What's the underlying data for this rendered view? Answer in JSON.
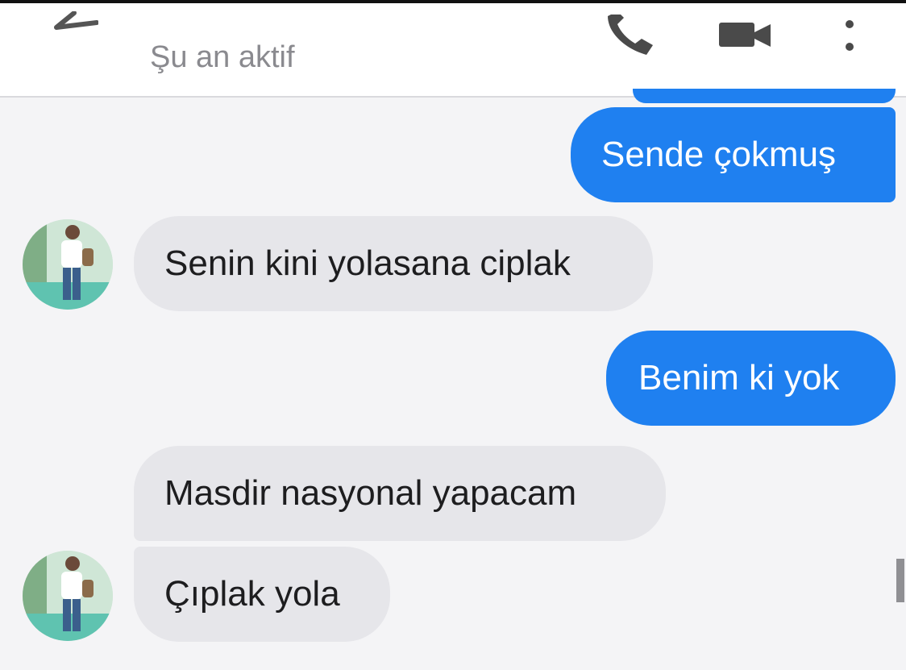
{
  "header": {
    "status": "Şu an aktif",
    "icons": {
      "back": "back-arrow-icon",
      "call": "phone-icon",
      "video": "video-camera-icon",
      "more": "more-vert-icon"
    }
  },
  "messages": [
    {
      "direction": "sent",
      "text": "Sende çokmuş"
    },
    {
      "direction": "received",
      "text": "Senin kini yolasana ciplak",
      "avatar": true
    },
    {
      "direction": "sent",
      "text": "Benim ki yok"
    },
    {
      "direction": "received",
      "text": "Masdir nasyonal yapacam",
      "avatar": false
    },
    {
      "direction": "received",
      "text": "Çıplak yola",
      "avatar": true
    }
  ],
  "colors": {
    "sent_bubble": "#1f80f0",
    "received_bubble": "#e6e6ea",
    "background": "#f4f4f6",
    "header_background": "#ffffff"
  }
}
